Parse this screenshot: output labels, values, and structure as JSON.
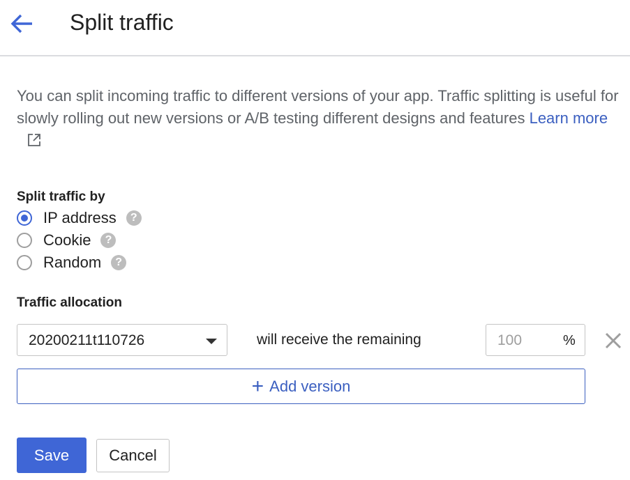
{
  "header": {
    "title": "Split traffic",
    "back_icon": "arrow-back-icon"
  },
  "description": {
    "text": "You can split incoming traffic to different versions of your app. Traffic splitting is useful for slowly rolling out new versions or A/B testing different designs and features",
    "link_label": "Learn more",
    "link_icon": "external-link-icon"
  },
  "split_by": {
    "label": "Split traffic by",
    "options": [
      {
        "label": "IP address",
        "checked": true,
        "help": "?"
      },
      {
        "label": "Cookie",
        "checked": false,
        "help": "?"
      },
      {
        "label": "Random",
        "checked": false,
        "help": "?"
      }
    ]
  },
  "allocation": {
    "label": "Traffic allocation",
    "version_value": "20200211t110726",
    "remaining_text": "will receive the remaining",
    "percent_value": "100",
    "percent_suffix": "%",
    "add_version_plus": "+",
    "add_version_label": "Add version"
  },
  "actions": {
    "save_label": "Save",
    "cancel_label": "Cancel"
  },
  "colors": {
    "accent": "#3f66d6",
    "link": "#3b5fc0",
    "muted_text": "#5f6368"
  }
}
